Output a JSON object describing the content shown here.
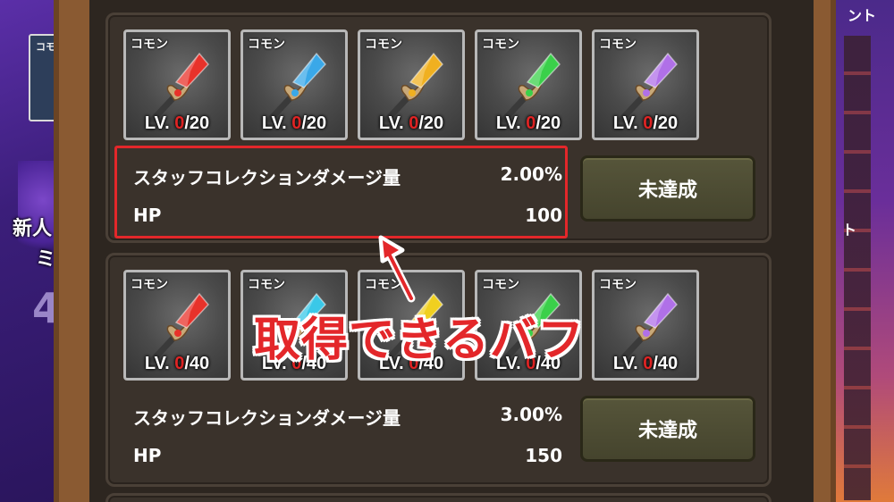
{
  "background": {
    "left_thumb_tag": "コモ",
    "left_text_1": "新人",
    "left_text_2": "ミ",
    "left_text_3": "4",
    "right_text_1": "ント",
    "right_text_2": "ト"
  },
  "collections": [
    {
      "cards": [
        {
          "rarity": "コモン",
          "level": "0",
          "max": "/20",
          "gem_color": "#e8322a",
          "lv_label": "LV."
        },
        {
          "rarity": "コモン",
          "level": "0",
          "max": "/20",
          "gem_color": "#3aa8e8",
          "lv_label": "LV."
        },
        {
          "rarity": "コモン",
          "level": "0",
          "max": "/20",
          "gem_color": "#f0b020",
          "lv_label": "LV."
        },
        {
          "rarity": "コモン",
          "level": "0",
          "max": "/20",
          "gem_color": "#3ad04a",
          "lv_label": "LV."
        },
        {
          "rarity": "コモン",
          "level": "0",
          "max": "/20",
          "gem_color": "#b070e8",
          "lv_label": "LV."
        }
      ],
      "stats": [
        {
          "label": "スタッフコレクションダメージ量",
          "value": "2.00%"
        },
        {
          "label": "HP",
          "value": "100"
        }
      ],
      "status": "未達成"
    },
    {
      "cards": [
        {
          "rarity": "コモン",
          "level": "0",
          "max": "/40",
          "gem_color": "#e8322a",
          "lv_label": "LV."
        },
        {
          "rarity": "コモン",
          "level": "0",
          "max": "/40",
          "gem_color": "#3ac8e8",
          "lv_label": "LV."
        },
        {
          "rarity": "コモン",
          "level": "0",
          "max": "/40",
          "gem_color": "#f0d020",
          "lv_label": "LV."
        },
        {
          "rarity": "コモン",
          "level": "0",
          "max": "/40",
          "gem_color": "#3ad04a",
          "lv_label": "LV."
        },
        {
          "rarity": "コモン",
          "level": "0",
          "max": "/40",
          "gem_color": "#b070e8",
          "lv_label": "LV."
        }
      ],
      "stats": [
        {
          "label": "スタッフコレクションダメージ量",
          "value": "3.00%"
        },
        {
          "label": "HP",
          "value": "150"
        }
      ],
      "status": "未達成"
    }
  ],
  "annotation": {
    "text": "取得できるバフ",
    "color": "#e3272a"
  }
}
